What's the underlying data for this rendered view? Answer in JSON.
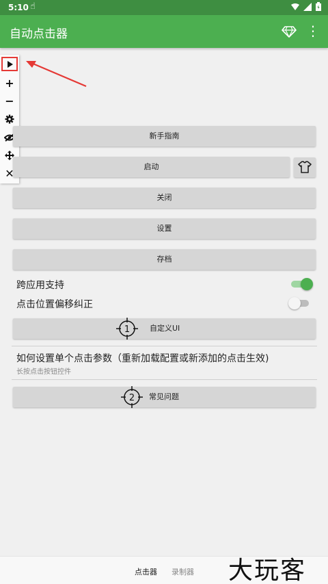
{
  "status_bar": {
    "time": "5:10"
  },
  "app_bar": {
    "title": "自动点击器"
  },
  "buttons": {
    "guide": "新手指南",
    "start": "启动",
    "close": "关闭",
    "settings": "设置",
    "archive": "存档",
    "custom_ui": "自定义UI",
    "faq": "常见问题"
  },
  "toggles": [
    {
      "label": "跨应用支持",
      "state": "on"
    },
    {
      "label": "点击位置偏移纠正",
      "state": "off"
    }
  ],
  "crosshair_numbers": [
    "1",
    "2"
  ],
  "info": {
    "title": "如何设置单个点击参数（重新加载配置或新添加的点击生效)",
    "subtitle": "长按点击按钮控件"
  },
  "bottom_nav": {
    "tabs": [
      "点击器",
      "录制器"
    ],
    "active": "点击器"
  },
  "watermark": "大玩客",
  "colors": {
    "primary": "#4caf50",
    "status_bar": "#3e8e41",
    "highlight": "#e53935"
  }
}
